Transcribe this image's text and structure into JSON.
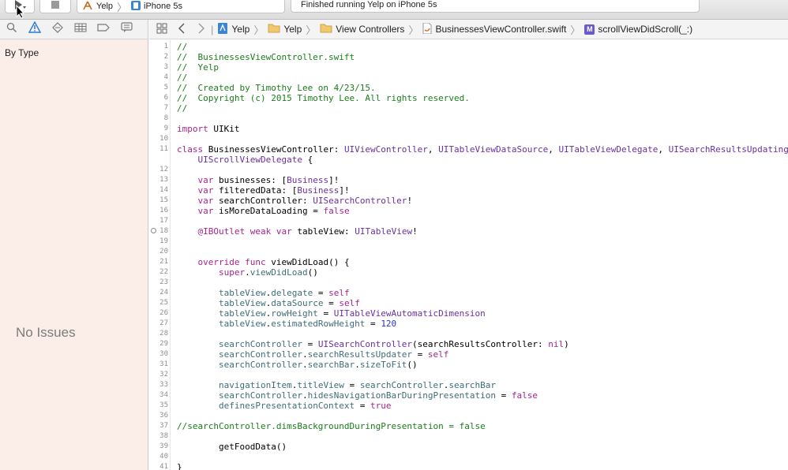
{
  "toolbar": {
    "scheme_target": "Yelp",
    "scheme_device": "iPhone 5s",
    "status": "Finished running Yelp on iPhone 5s"
  },
  "navigator": {
    "filter_label": "By Type",
    "empty_message": "No Issues",
    "tab_icons": [
      "folder-search-icon",
      "issue-warning-icon",
      "test-diamond-icon",
      "debug-gauge-icon",
      "breakpoint-icon",
      "report-bubble-icon"
    ]
  },
  "jumpbar": {
    "crumbs": [
      "Yelp",
      "Yelp",
      "View Controllers",
      "BusinessesViewController.swift",
      "scrollViewDidScroll(_:)"
    ],
    "method_badge": "M"
  },
  "editor": {
    "lines": [
      {
        "n": "1",
        "t": [
          [
            "c",
            "//"
          ]
        ]
      },
      {
        "n": "2",
        "t": [
          [
            "c",
            "//  BusinessesViewController.swift"
          ]
        ]
      },
      {
        "n": "3",
        "t": [
          [
            "c",
            "//  Yelp"
          ]
        ]
      },
      {
        "n": "4",
        "t": [
          [
            "c",
            "//"
          ]
        ]
      },
      {
        "n": "5",
        "t": [
          [
            "c",
            "//  Created by Timothy Lee on 4/23/15."
          ]
        ]
      },
      {
        "n": "6",
        "t": [
          [
            "c",
            "//  Copyright (c) 2015 Timothy Lee. All rights reserved."
          ]
        ]
      },
      {
        "n": "7",
        "t": [
          [
            "c",
            "//"
          ]
        ]
      },
      {
        "n": "8",
        "t": []
      },
      {
        "n": "9",
        "t": [
          [
            "k",
            "import"
          ],
          [
            "p",
            " UIKit"
          ]
        ]
      },
      {
        "n": "10",
        "t": []
      },
      {
        "n": "11",
        "t": [
          [
            "k",
            "class"
          ],
          [
            "p",
            " BusinessesViewController: "
          ],
          [
            "y",
            "UIViewController"
          ],
          [
            "p",
            ", "
          ],
          [
            "y",
            "UITableViewDataSource"
          ],
          [
            "p",
            ", "
          ],
          [
            "y",
            "UITableViewDelegate"
          ],
          [
            "p",
            ", "
          ],
          [
            "y",
            "UISearchResultsUpdating"
          ],
          [
            "p",
            ","
          ]
        ]
      },
      {
        "n": "",
        "t": [
          [
            "p",
            "    "
          ],
          [
            "y",
            "UIScrollViewDelegate"
          ],
          [
            "p",
            " {"
          ]
        ]
      },
      {
        "n": "12",
        "t": []
      },
      {
        "n": "13",
        "t": [
          [
            "p",
            "    "
          ],
          [
            "k",
            "var"
          ],
          [
            "p",
            " businesses: ["
          ],
          [
            "y",
            "Business"
          ],
          [
            "p",
            "]!"
          ]
        ]
      },
      {
        "n": "14",
        "t": [
          [
            "p",
            "    "
          ],
          [
            "k",
            "var"
          ],
          [
            "p",
            " filteredData: ["
          ],
          [
            "y",
            "Business"
          ],
          [
            "p",
            "]!"
          ]
        ]
      },
      {
        "n": "15",
        "t": [
          [
            "p",
            "    "
          ],
          [
            "k",
            "var"
          ],
          [
            "p",
            " searchController: "
          ],
          [
            "y",
            "UISearchController"
          ],
          [
            "p",
            "!"
          ]
        ]
      },
      {
        "n": "16",
        "t": [
          [
            "p",
            "    "
          ],
          [
            "k",
            "var"
          ],
          [
            "p",
            " isMoreDataLoading = "
          ],
          [
            "k",
            "false"
          ]
        ]
      },
      {
        "n": "17",
        "t": []
      },
      {
        "n": "18",
        "t": [
          [
            "p",
            "    "
          ],
          [
            "k",
            "@IBOutlet"
          ],
          [
            "p",
            " "
          ],
          [
            "k",
            "weak"
          ],
          [
            "p",
            " "
          ],
          [
            "k",
            "var"
          ],
          [
            "p",
            " tableView: "
          ],
          [
            "y",
            "UITableView"
          ],
          [
            "p",
            "!"
          ]
        ],
        "outlet": true
      },
      {
        "n": "19",
        "t": []
      },
      {
        "n": "20",
        "t": []
      },
      {
        "n": "21",
        "t": [
          [
            "p",
            "    "
          ],
          [
            "k",
            "override"
          ],
          [
            "p",
            " "
          ],
          [
            "k",
            "func"
          ],
          [
            "p",
            " viewDidLoad() {"
          ]
        ]
      },
      {
        "n": "22",
        "t": [
          [
            "p",
            "        "
          ],
          [
            "k",
            "super"
          ],
          [
            "p",
            "."
          ],
          [
            "r",
            "viewDidLoad"
          ],
          [
            "p",
            "()"
          ]
        ]
      },
      {
        "n": "23",
        "t": []
      },
      {
        "n": "24",
        "t": [
          [
            "p",
            "        "
          ],
          [
            "r",
            "tableView"
          ],
          [
            "p",
            "."
          ],
          [
            "r",
            "delegate"
          ],
          [
            "p",
            " = "
          ],
          [
            "k",
            "self"
          ]
        ]
      },
      {
        "n": "25",
        "t": [
          [
            "p",
            "        "
          ],
          [
            "r",
            "tableView"
          ],
          [
            "p",
            "."
          ],
          [
            "r",
            "dataSource"
          ],
          [
            "p",
            " = "
          ],
          [
            "k",
            "self"
          ]
        ]
      },
      {
        "n": "26",
        "t": [
          [
            "p",
            "        "
          ],
          [
            "r",
            "tableView"
          ],
          [
            "p",
            "."
          ],
          [
            "r",
            "rowHeight"
          ],
          [
            "p",
            " = "
          ],
          [
            "y",
            "UITableViewAutomaticDimension"
          ]
        ]
      },
      {
        "n": "27",
        "t": [
          [
            "p",
            "        "
          ],
          [
            "r",
            "tableView"
          ],
          [
            "p",
            "."
          ],
          [
            "r",
            "estimatedRowHeight"
          ],
          [
            "p",
            " = "
          ],
          [
            "d",
            "120"
          ]
        ]
      },
      {
        "n": "28",
        "t": []
      },
      {
        "n": "29",
        "t": [
          [
            "p",
            "        "
          ],
          [
            "r",
            "searchController"
          ],
          [
            "p",
            " = "
          ],
          [
            "y",
            "UISearchController"
          ],
          [
            "p",
            "(searchResultsController: "
          ],
          [
            "k",
            "nil"
          ],
          [
            "p",
            ")"
          ]
        ]
      },
      {
        "n": "30",
        "t": [
          [
            "p",
            "        "
          ],
          [
            "r",
            "searchController"
          ],
          [
            "p",
            "."
          ],
          [
            "r",
            "searchResultsUpdater"
          ],
          [
            "p",
            " = "
          ],
          [
            "k",
            "self"
          ]
        ]
      },
      {
        "n": "31",
        "t": [
          [
            "p",
            "        "
          ],
          [
            "r",
            "searchController"
          ],
          [
            "p",
            "."
          ],
          [
            "r",
            "searchBar"
          ],
          [
            "p",
            "."
          ],
          [
            "r",
            "sizeToFit"
          ],
          [
            "p",
            "()"
          ]
        ]
      },
      {
        "n": "32",
        "t": []
      },
      {
        "n": "33",
        "t": [
          [
            "p",
            "        "
          ],
          [
            "r",
            "navigationItem"
          ],
          [
            "p",
            "."
          ],
          [
            "r",
            "titleView"
          ],
          [
            "p",
            " = "
          ],
          [
            "r",
            "searchController"
          ],
          [
            "p",
            "."
          ],
          [
            "r",
            "searchBar"
          ]
        ]
      },
      {
        "n": "34",
        "t": [
          [
            "p",
            "        "
          ],
          [
            "r",
            "searchController"
          ],
          [
            "p",
            "."
          ],
          [
            "r",
            "hidesNavigationBarDuringPresentation"
          ],
          [
            "p",
            " = "
          ],
          [
            "k",
            "false"
          ]
        ]
      },
      {
        "n": "35",
        "t": [
          [
            "p",
            "        "
          ],
          [
            "r",
            "definesPresentationContext"
          ],
          [
            "p",
            " = "
          ],
          [
            "k",
            "true"
          ]
        ]
      },
      {
        "n": "36",
        "t": []
      },
      {
        "n": "37",
        "t": [
          [
            "c",
            "//searchController.dimsBackgroundDuringPresentation = false"
          ]
        ]
      },
      {
        "n": "38",
        "t": []
      },
      {
        "n": "39",
        "t": [
          [
            "p",
            "        getFoodData()"
          ]
        ]
      },
      {
        "n": "40",
        "t": []
      },
      {
        "n": "41",
        "t": [
          [
            "p",
            "}"
          ]
        ]
      }
    ]
  }
}
